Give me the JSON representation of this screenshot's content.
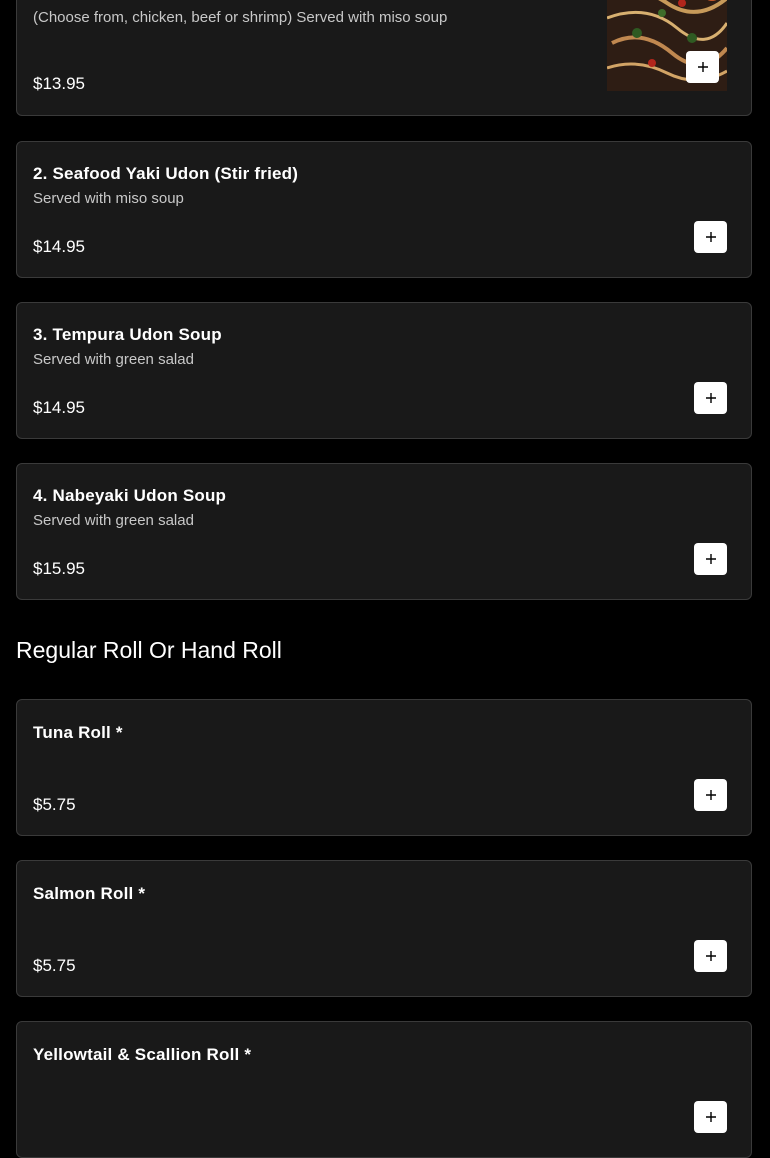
{
  "first_item": {
    "description": "(Choose from, chicken, beef or shrimp) Served with miso soup",
    "price": "$13.95"
  },
  "udon_items": [
    {
      "name": "2. Seafood Yaki Udon (Stir fried)",
      "description": "Served with miso soup",
      "price": "$14.95"
    },
    {
      "name": "3. Tempura Udon Soup",
      "description": "Served with green salad",
      "price": "$14.95"
    },
    {
      "name": "4. Nabeyaki Udon Soup",
      "description": "Served with green salad",
      "price": "$15.95"
    }
  ],
  "roll_section": {
    "title": "Regular Roll Or Hand Roll",
    "items": [
      {
        "name": "Tuna Roll *",
        "price": "$5.75"
      },
      {
        "name": "Salmon Roll *",
        "price": "$5.75"
      },
      {
        "name": "Yellowtail & Scallion Roll *"
      }
    ]
  },
  "colors": {
    "background": "#000000",
    "card": "#191919",
    "card_border": "#3a3a3a",
    "button": "#ffffff"
  },
  "icons": {
    "add": "plus-icon"
  }
}
